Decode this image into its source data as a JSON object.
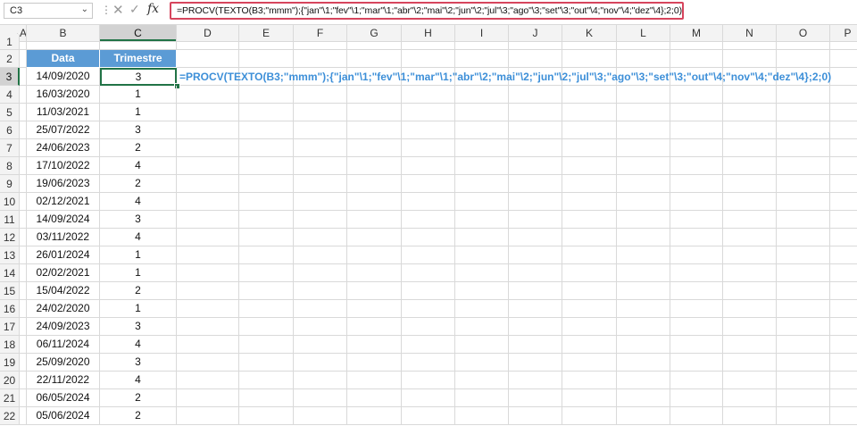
{
  "name_box": {
    "value": "C3"
  },
  "formula_bar": {
    "formula": "=PROCV(TEXTO(B3;\"mmm\");{\"jan\"\\1;\"fev\"\\1;\"mar\"\\1;\"abr\"\\2;\"mai\"\\2;\"jun\"\\2;\"jul\"\\3;\"ago\"\\3;\"set\"\\3;\"out\"\\4;\"nov\"\\4;\"dez\"\\4};2;0)",
    "cancel_symbol": "✕",
    "enter_symbol": "✓",
    "fx_label": "fx"
  },
  "columns": [
    "A",
    "B",
    "C",
    "D",
    "E",
    "F",
    "G",
    "H",
    "I",
    "J",
    "K",
    "L",
    "M",
    "N",
    "O",
    "P"
  ],
  "row_numbers": [
    "1",
    "2",
    "3",
    "4",
    "5",
    "6",
    "7",
    "8",
    "9",
    "10",
    "11",
    "12",
    "13",
    "14",
    "15",
    "16",
    "17",
    "18",
    "19",
    "20",
    "21",
    "22"
  ],
  "table": {
    "headers": [
      "Data",
      "Trimestre"
    ],
    "rows": [
      [
        "14/09/2020",
        "3"
      ],
      [
        "16/03/2020",
        "1"
      ],
      [
        "11/03/2021",
        "1"
      ],
      [
        "25/07/2022",
        "3"
      ],
      [
        "24/06/2023",
        "2"
      ],
      [
        "17/10/2022",
        "4"
      ],
      [
        "19/06/2023",
        "2"
      ],
      [
        "02/12/2021",
        "4"
      ],
      [
        "14/09/2024",
        "3"
      ],
      [
        "03/11/2022",
        "4"
      ],
      [
        "26/01/2024",
        "1"
      ],
      [
        "02/02/2021",
        "1"
      ],
      [
        "15/04/2022",
        "2"
      ],
      [
        "24/02/2020",
        "1"
      ],
      [
        "24/09/2023",
        "3"
      ],
      [
        "06/11/2024",
        "4"
      ],
      [
        "25/09/2020",
        "3"
      ],
      [
        "22/11/2022",
        "4"
      ],
      [
        "06/05/2024",
        "2"
      ],
      [
        "05/06/2024",
        "2"
      ]
    ]
  },
  "annotation_formula": "=PROCV(TEXTO(B3;\"mmm\");{\"jan\"\\1;\"fev\"\\1;\"mar\"\\1;\"abr\"\\2;\"mai\"\\2;\"jun\"\\2;\"jul\"\\3;\"ago\"\\3;\"set\"\\3;\"out\"\\4;\"nov\"\\4;\"dez\"\\4};2;0)",
  "colors": {
    "header_fill": "#5b9bd5",
    "selection": "#217346",
    "formula_highlight": "#d6455d",
    "annotation_text": "#3d8fd8"
  }
}
